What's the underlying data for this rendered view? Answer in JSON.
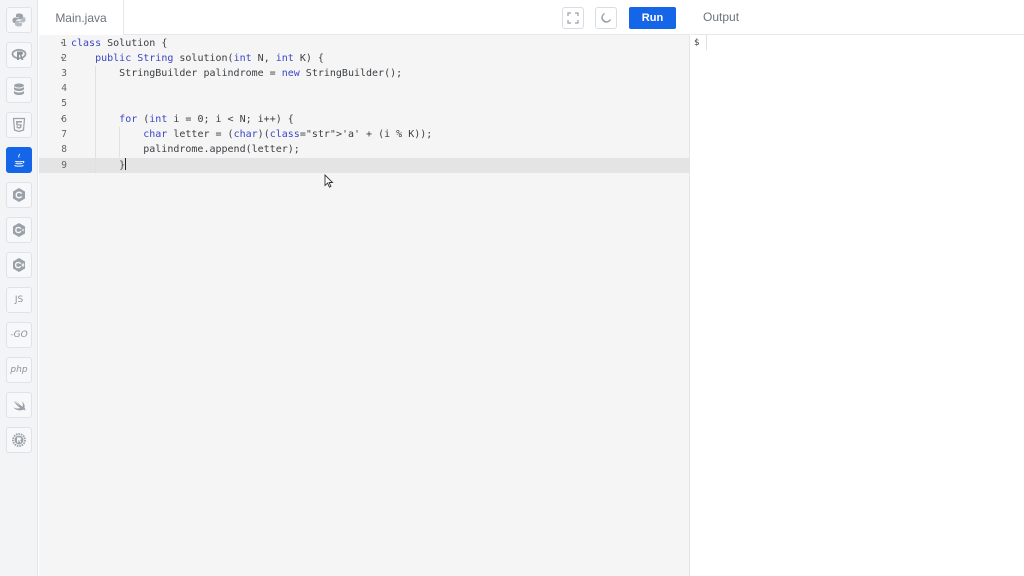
{
  "sidebar": {
    "languages": [
      {
        "name": "python",
        "icon": "python-icon"
      },
      {
        "name": "r",
        "icon": "r-icon"
      },
      {
        "name": "sql",
        "icon": "database-icon"
      },
      {
        "name": "html",
        "icon": "html5-icon"
      },
      {
        "name": "java",
        "icon": "java-icon",
        "active": true
      },
      {
        "name": "c",
        "icon": "c-icon"
      },
      {
        "name": "cpp",
        "icon": "cpp-icon"
      },
      {
        "name": "csharp",
        "icon": "csharp-icon"
      },
      {
        "name": "javascript",
        "label": "JS"
      },
      {
        "name": "go",
        "label": "-GO"
      },
      {
        "name": "php",
        "label": "php"
      },
      {
        "name": "swift",
        "icon": "swift-icon"
      },
      {
        "name": "rust",
        "icon": "rust-icon"
      }
    ],
    "js_label": "JS",
    "go_label": "-GO",
    "php_label": "php"
  },
  "editor": {
    "file_tab": "Main.java",
    "run_label": "Run",
    "lines": [
      {
        "num": "1",
        "fold": "▾",
        "text": "class Solution {"
      },
      {
        "num": "2",
        "fold": "▾",
        "text": "    public String solution(int N, int K) {"
      },
      {
        "num": "3",
        "fold": "",
        "text": "        StringBuilder palindrome = new StringBuilder();"
      },
      {
        "num": "4",
        "fold": "",
        "text": ""
      },
      {
        "num": "5",
        "fold": "",
        "text": ""
      },
      {
        "num": "6",
        "fold": "▾",
        "text": "        for (int i = 0; i < N; i++) {"
      },
      {
        "num": "7",
        "fold": "",
        "text": "            char letter = (char)('a' + (i % K));"
      },
      {
        "num": "8",
        "fold": "",
        "text": "            palindrome.append(letter);"
      },
      {
        "num": "9",
        "fold": "",
        "text": "        }"
      }
    ],
    "active_line": 9
  },
  "output": {
    "title": "Output",
    "prompt": "$"
  },
  "colors": {
    "accent": "#1565e8",
    "keyword": "#3d46c4",
    "string": "#4a8a2a"
  }
}
